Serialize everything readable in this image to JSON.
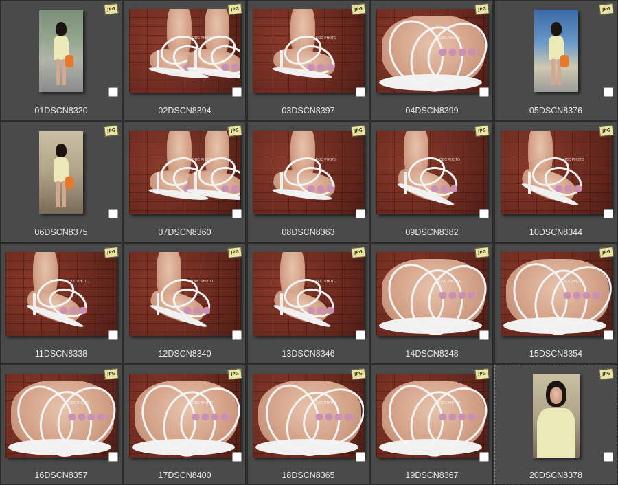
{
  "gallery": {
    "badge_label": "JPG",
    "watermark": "DDC PHOTO",
    "items": [
      {
        "name": "01DSCN8320",
        "kind": "portrait",
        "scene": "a"
      },
      {
        "name": "02DSCN8394",
        "kind": "landscape",
        "scene": "pair"
      },
      {
        "name": "03DSCN8397",
        "kind": "landscape",
        "scene": "front"
      },
      {
        "name": "04DSCN8399",
        "kind": "landscape",
        "scene": "closeup"
      },
      {
        "name": "05DSCN8376",
        "kind": "portrait",
        "scene": "b"
      },
      {
        "name": "06DSCN8375",
        "kind": "portrait",
        "scene": "c"
      },
      {
        "name": "07DSCN8360",
        "kind": "landscape",
        "scene": "pair"
      },
      {
        "name": "08DSCN8363",
        "kind": "landscape",
        "scene": "front"
      },
      {
        "name": "09DSCN8382",
        "kind": "landscape",
        "scene": "side"
      },
      {
        "name": "10DSCN8344",
        "kind": "landscape",
        "scene": "side"
      },
      {
        "name": "11DSCN8338",
        "kind": "landscape",
        "scene": "side"
      },
      {
        "name": "12DSCN8340",
        "kind": "landscape",
        "scene": "side"
      },
      {
        "name": "13DSCN8346",
        "kind": "landscape",
        "scene": "side"
      },
      {
        "name": "14DSCN8348",
        "kind": "landscape",
        "scene": "closeup"
      },
      {
        "name": "15DSCN8354",
        "kind": "landscape",
        "scene": "closeup"
      },
      {
        "name": "16DSCN8357",
        "kind": "landscape",
        "scene": "closeup"
      },
      {
        "name": "17DSCN8400",
        "kind": "landscape",
        "scene": "closeup"
      },
      {
        "name": "18DSCN8365",
        "kind": "landscape",
        "scene": "closeup"
      },
      {
        "name": "19DSCN8367",
        "kind": "landscape",
        "scene": "closeup"
      },
      {
        "name": "20DSCN8378",
        "kind": "portrait",
        "scene": "d",
        "selected": true
      }
    ]
  },
  "colors": {
    "background": "#2d2d2d",
    "cell": "#4a4a4a",
    "label": "#e6e6e6",
    "badge": "#e9e3a4"
  },
  "icons": {
    "badge": "jpg-file-icon",
    "checkbox": "checkbox-icon"
  }
}
